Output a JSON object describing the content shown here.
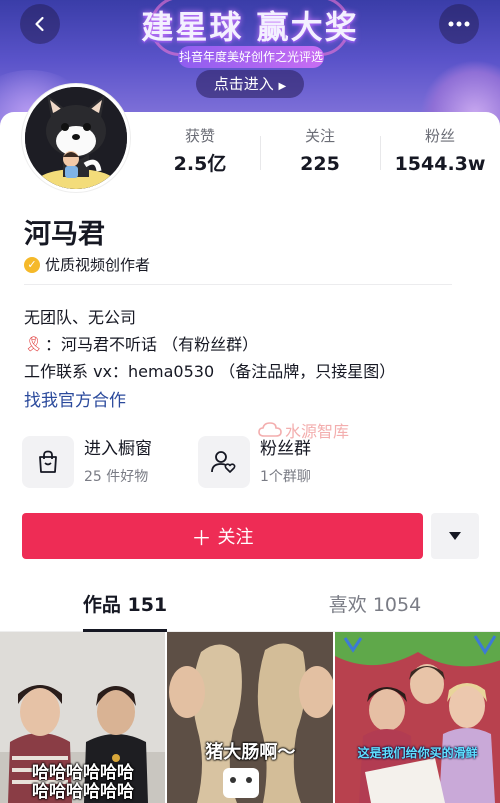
{
  "banner": {
    "title": "建星球 赢大奖",
    "subtitle": "抖音年度美好创作之光评选",
    "cta": "点击进入"
  },
  "profile": {
    "name": "河马君",
    "verification": "优质视频创作者",
    "stats": [
      {
        "label": "获赞",
        "value": "2.5亿"
      },
      {
        "label": "关注",
        "value": "225"
      },
      {
        "label": "粉丝",
        "value": "1544.3w"
      }
    ],
    "bio": {
      "line1": "无团队、无公司",
      "line2": "：河马君不听话 （有粉丝群）",
      "line3": "工作联系 vx：hema0530 （备注品牌，只接星图）"
    },
    "official_link": "找我官方合作"
  },
  "watermark": "水源智库",
  "shortcuts": [
    {
      "title": "进入橱窗",
      "subtitle": "25 件好物",
      "icon": "shopping-bag-icon"
    },
    {
      "title": "粉丝群",
      "subtitle": "1个群聊",
      "icon": "fan-group-icon"
    }
  ],
  "actions": {
    "follow_label": "关注"
  },
  "tabs": [
    {
      "label": "作品 151",
      "active": true
    },
    {
      "label": "喜欢 1054",
      "active": false
    }
  ],
  "thumbnails": [
    {
      "caption": "哈哈哈哈哈哈\n哈哈哈哈哈哈"
    },
    {
      "caption": "猪大肠啊～"
    },
    {
      "caption": "这是我们给你买的滑鲜"
    }
  ],
  "colors": {
    "follow_button": "#ee2c55",
    "link": "#2b4a9c",
    "verify_badge": "#f5b92a"
  }
}
